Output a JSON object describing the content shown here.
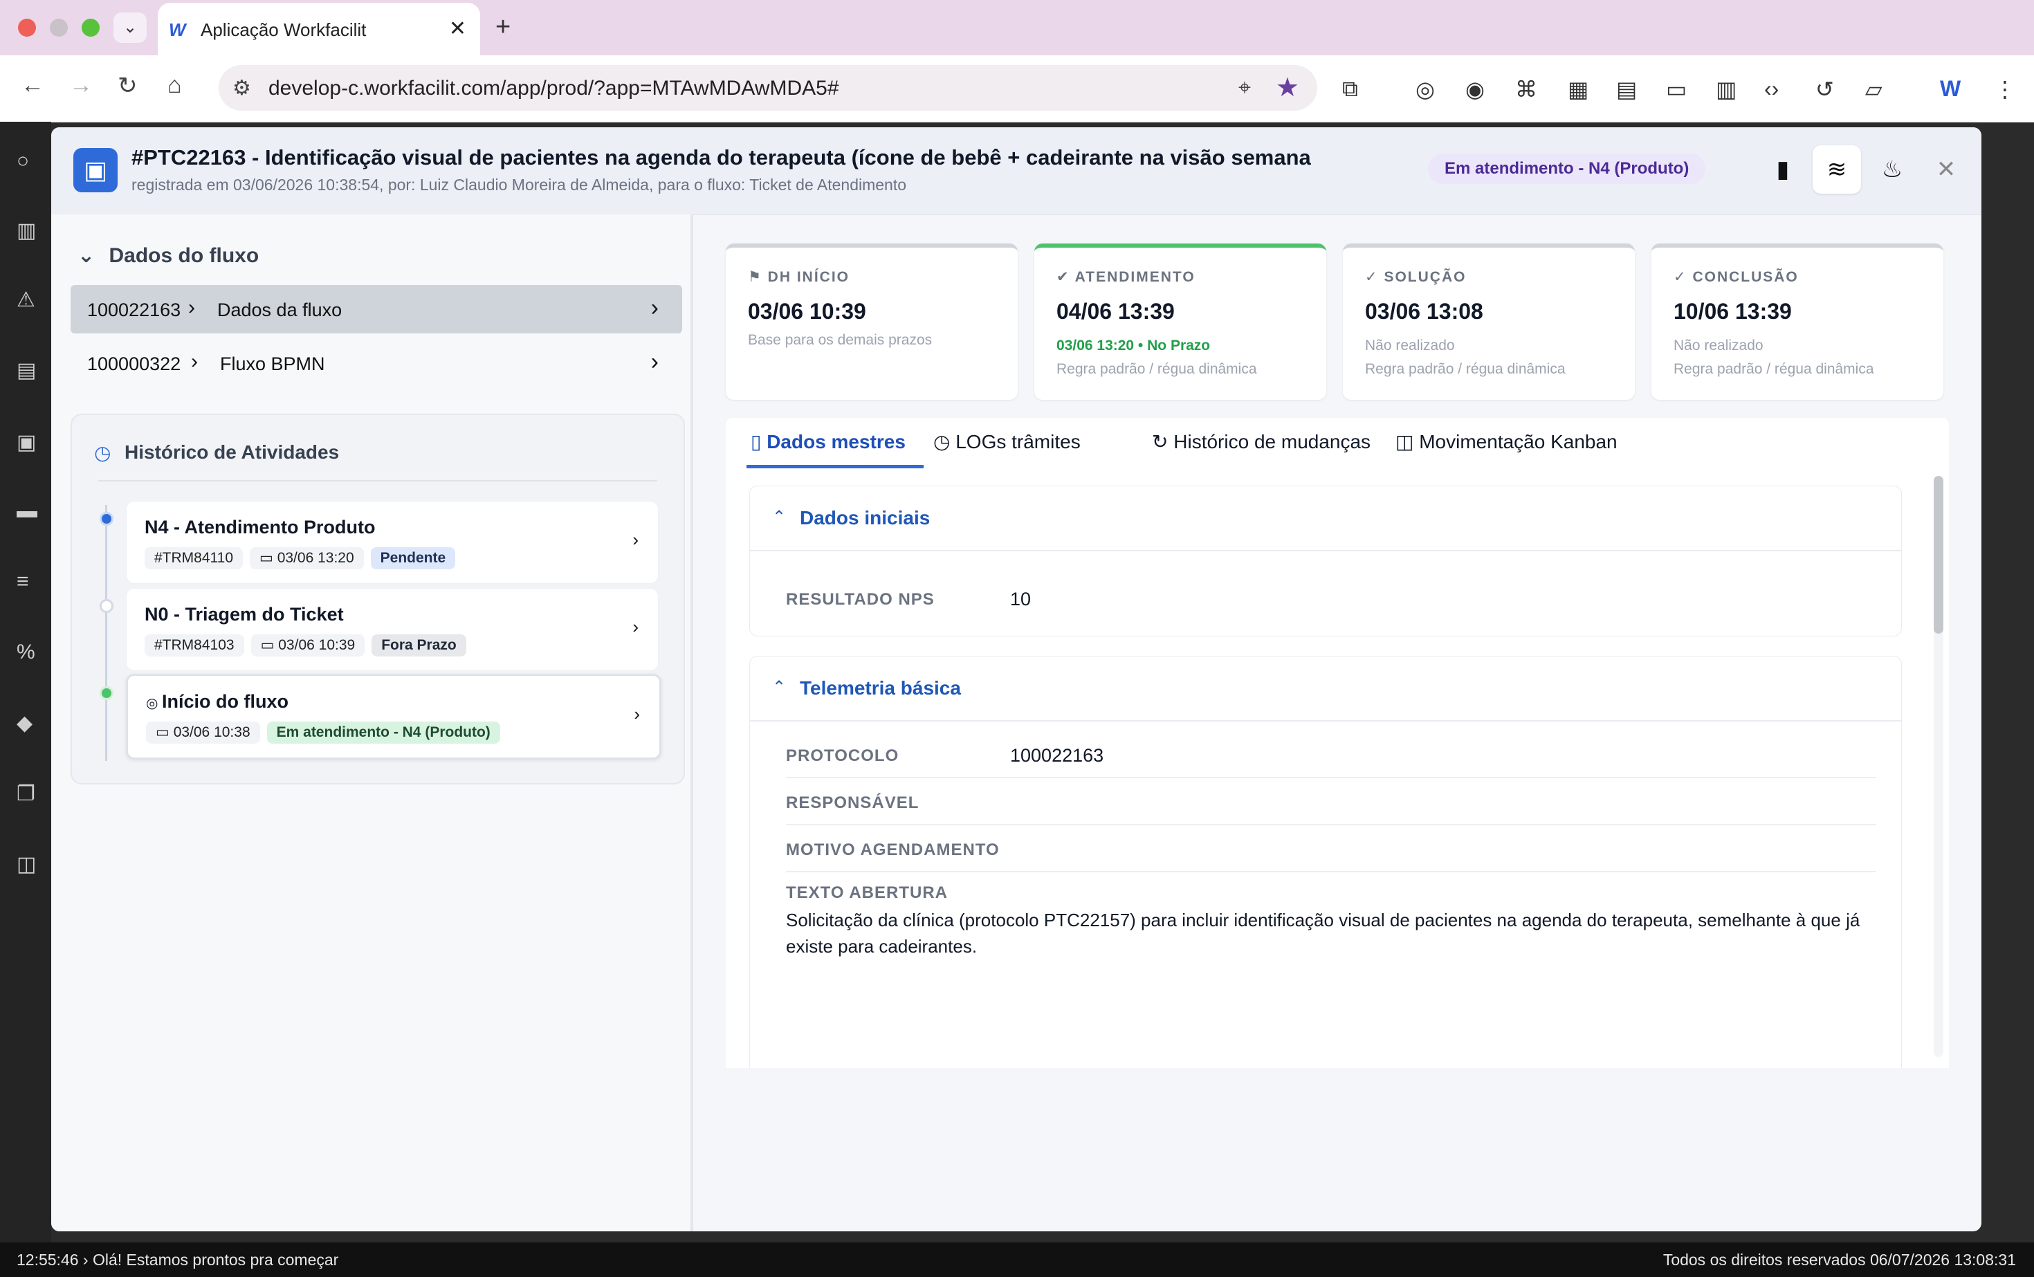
{
  "browser": {
    "tab_title": "Aplicação Workfacilit",
    "url": "develop-c.workfacilit.com/app/prod/?app=MTAwMDAwMDA5#"
  },
  "modal": {
    "title": "#PTC22163 - Identificação visual de pacientes na agenda do terapeuta (ícone de bebê + cadeirante na visão semana",
    "subtitle": "registrada em 03/06/2026 10:38:54, por: Luiz Claudio Moreira de Almeida, para o fluxo: Ticket de Atendimento",
    "status_badge": "Em atendimento - N4 (Produto)"
  },
  "left": {
    "section_title": "Dados do fluxo",
    "flows": [
      {
        "code": "100022163",
        "name": "Dados da fluxo"
      },
      {
        "code": "100000322",
        "name": "Fluxo BPMN"
      }
    ],
    "history_title": "Histórico de Atividades",
    "activities": [
      {
        "title": "N4 - Atendimento Produto",
        "code": "#TRM84110",
        "date": "03/06 13:20",
        "status": "Pendente"
      },
      {
        "title": "N0 - Triagem do Ticket",
        "code": "#TRM84103",
        "date": "03/06 10:39",
        "status": "Fora Prazo"
      },
      {
        "title": "Início do fluxo",
        "date": "03/06 10:38",
        "status": "Em atendimento - N4 (Produto)"
      }
    ]
  },
  "kpis": [
    {
      "label": "DH INÍCIO",
      "value": "03/06 10:39",
      "sub1": "Base para os demais prazos",
      "sub2": ""
    },
    {
      "label": "ATENDIMENTO",
      "value": "04/06 13:39",
      "sub1": "03/06 13:20 • No Prazo",
      "sub2": "Regra padrão / régua dinâmica"
    },
    {
      "label": "SOLUÇÃO",
      "value": "03/06 13:08",
      "sub1": "Não realizado",
      "sub2": "Regra padrão / régua dinâmica"
    },
    {
      "label": "CONCLUSÃO",
      "value": "10/06 13:39",
      "sub1": "Não realizado",
      "sub2": "Regra padrão / régua dinâmica"
    }
  ],
  "tabs": [
    "Dados mestres",
    "LOGs trâmites",
    "Histórico de mudanças",
    "Movimentação Kanban"
  ],
  "sections": {
    "initial_title": "Dados iniciais",
    "nps_label": "RESULTADO NPS",
    "nps_value": "10",
    "telemetry_title": "Telemetria básica",
    "protocolo_label": "PROTOCOLO",
    "protocolo_value": "100022163",
    "responsavel_label": "RESPONSÁVEL",
    "motivo_label": "MOTIVO AGENDAMENTO",
    "texto_label": "TEXTO ABERTURA",
    "texto_value": "Solicitação da clínica (protocolo PTC22157) para incluir identificação visual de pacientes na agenda do terapeuta, semelhante à que já existe para cadeirantes."
  },
  "status_bar": {
    "left": "12:55:46 › Olá! Estamos prontos pra começar",
    "right": "Todos os direitos reservados 06/07/2026 13:08:31"
  },
  "colors": {
    "accent": "#2f6bd8",
    "success": "#4cc26a",
    "badge_bg": "#ece6fb"
  }
}
